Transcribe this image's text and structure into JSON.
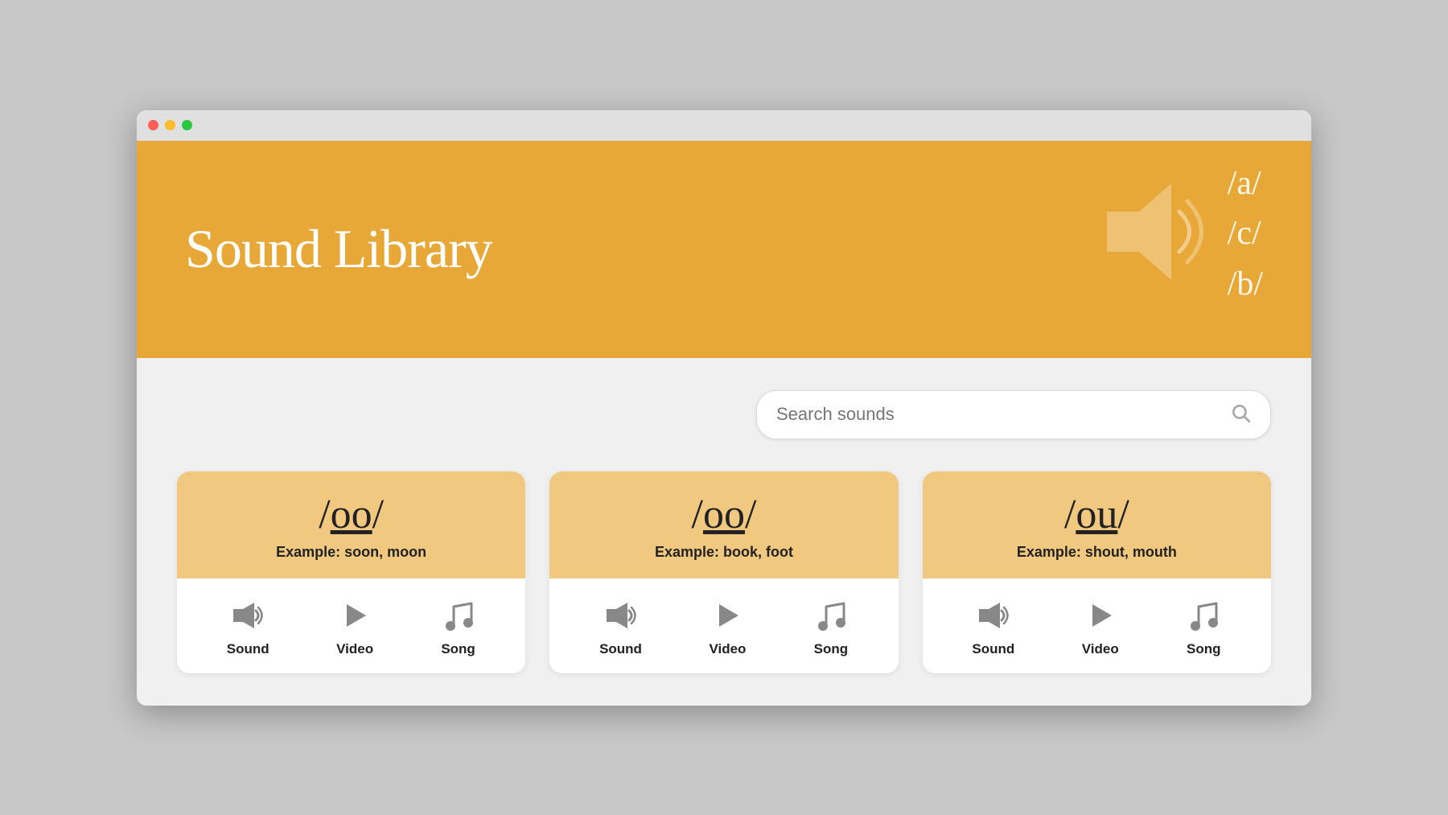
{
  "window": {
    "title": "Sound Library"
  },
  "header": {
    "title": "Sound Library",
    "phoneme_symbols": [
      "/a/",
      "/c/",
      "/b/"
    ]
  },
  "search": {
    "placeholder": "Search sounds",
    "value": ""
  },
  "cards": [
    {
      "id": "card-1",
      "phoneme_prefix": "/",
      "phoneme_main": "oo",
      "phoneme_suffix": "/",
      "example_label": "Example:",
      "example_words": "soon, moon",
      "actions": [
        {
          "label": "Sound",
          "type": "sound"
        },
        {
          "label": "Video",
          "type": "video"
        },
        {
          "label": "Song",
          "type": "song"
        }
      ]
    },
    {
      "id": "card-2",
      "phoneme_prefix": "/",
      "phoneme_main": "oo",
      "phoneme_suffix": "/",
      "example_label": "Example:",
      "example_words": "book, foot",
      "actions": [
        {
          "label": "Sound",
          "type": "sound"
        },
        {
          "label": "Video",
          "type": "video"
        },
        {
          "label": "Song",
          "type": "song"
        }
      ]
    },
    {
      "id": "card-3",
      "phoneme_prefix": "/",
      "phoneme_main": "ou",
      "phoneme_suffix": "/",
      "example_label": "Example:",
      "example_words": "shout, mouth",
      "actions": [
        {
          "label": "Sound",
          "type": "sound"
        },
        {
          "label": "Video",
          "type": "video"
        },
        {
          "label": "Song",
          "type": "song"
        }
      ]
    }
  ],
  "colors": {
    "banner_bg": "#e8a838",
    "card_header_bg": "#f0c880",
    "card_bg": "#ffffff"
  }
}
